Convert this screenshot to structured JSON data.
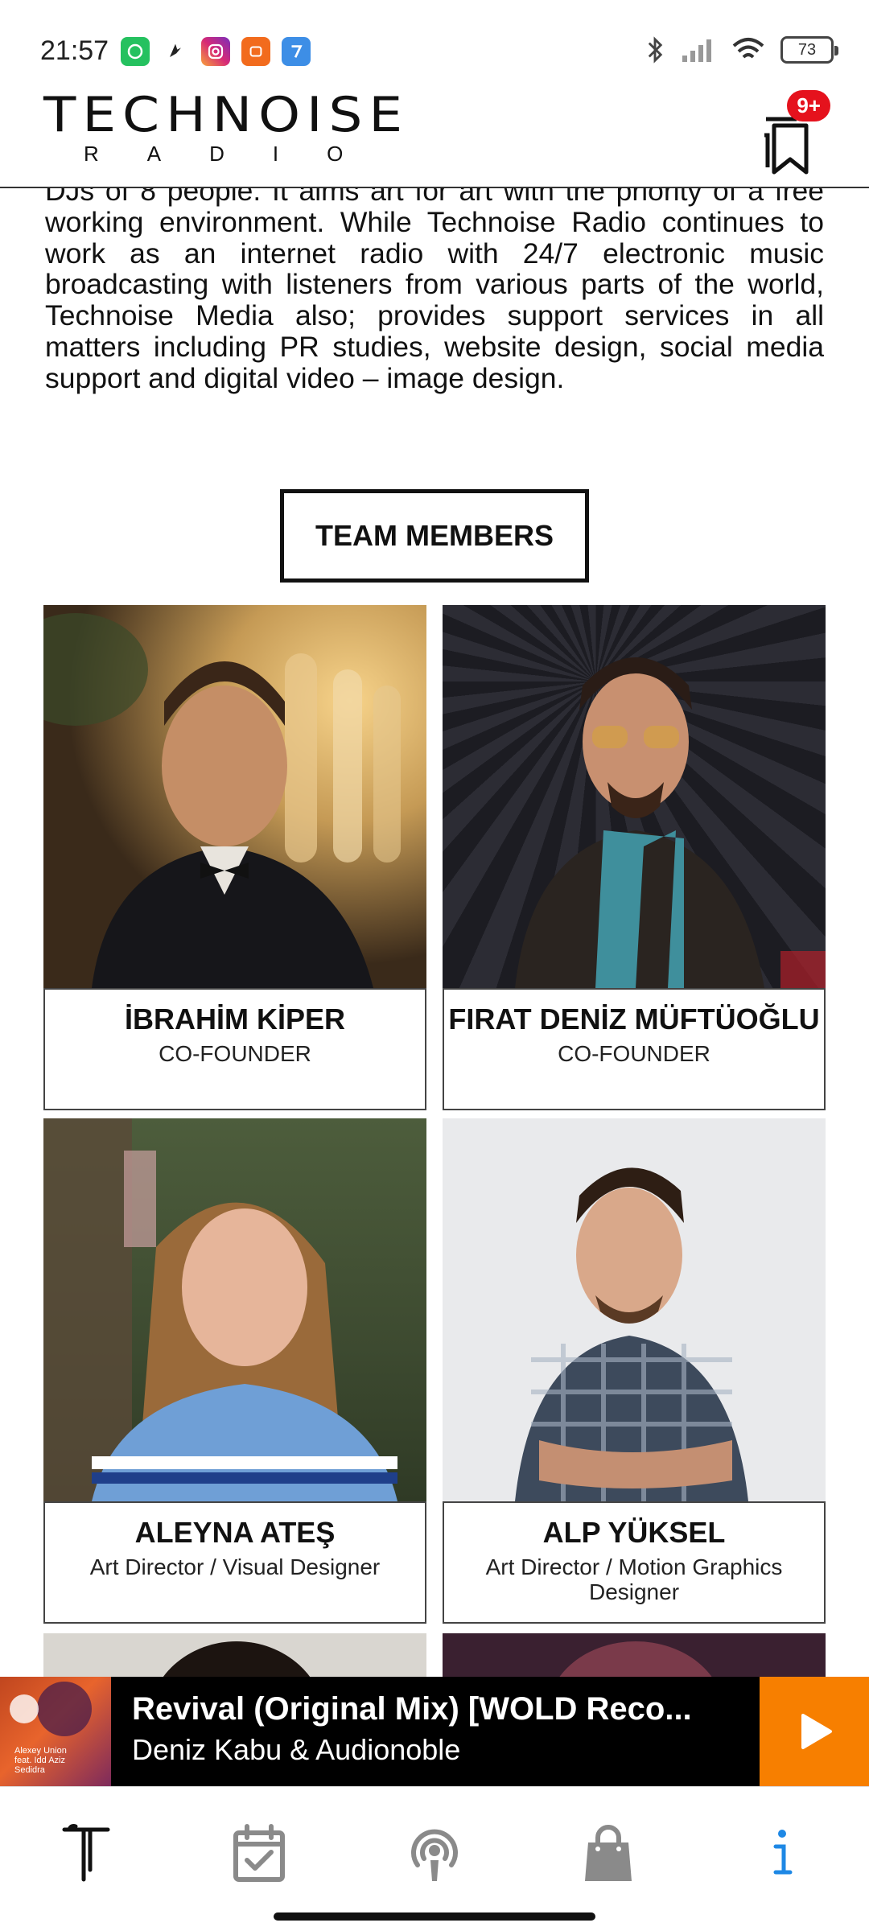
{
  "status_bar": {
    "time": "21:57",
    "battery": "73",
    "notification_icons": [
      "whatsapp-icon",
      "bird-app-icon",
      "instagram-icon",
      "mi-app-icon",
      "seven-app-icon"
    ]
  },
  "header": {
    "logo_main": "TECHNOISE",
    "logo_sub": "RADIO",
    "bookmark_badge": "9+"
  },
  "about": {
    "text": "DJs of 8 people. It aims art for art with the priority of a free working environment. While Technoise Radio continues to work as an internet radio with 24/7 electronic music broadcasting with listeners from various parts of the world, Technoise Media also; provides support services in all matters including PR studies, website design, social media support and digital video – image design."
  },
  "team": {
    "button_label": "TEAM MEMBERS",
    "members": [
      {
        "name": "İBRAHİM KİPER",
        "role": "CO-FOUNDER"
      },
      {
        "name": "FIRAT DENİZ MÜFTÜOĞLU",
        "role": "CO-FOUNDER"
      },
      {
        "name": "ALEYNA ATEŞ",
        "role": "Art Director / Visual Designer"
      },
      {
        "name": "ALP YÜKSEL",
        "role": "Art Director / Motion Graphics Designer"
      }
    ]
  },
  "player": {
    "title": "Revival (Original Mix) [WOLD Reco...",
    "artist": "Deniz Kabu & Audionoble",
    "cover_text": [
      "Alexey Union",
      "feat. Idd Aziz",
      "Sedidra"
    ]
  },
  "colors": {
    "accent_orange": "#f77f00",
    "badge_red": "#e5121d",
    "nav_active_blue": "#1e88e5",
    "nav_inactive_gray": "#8a8a8a"
  },
  "bottom_nav": {
    "items": [
      "technoise-logo-icon",
      "calendar-check-icon",
      "podcast-icon",
      "shopping-bag-icon",
      "info-icon"
    ],
    "active": "info-icon"
  }
}
